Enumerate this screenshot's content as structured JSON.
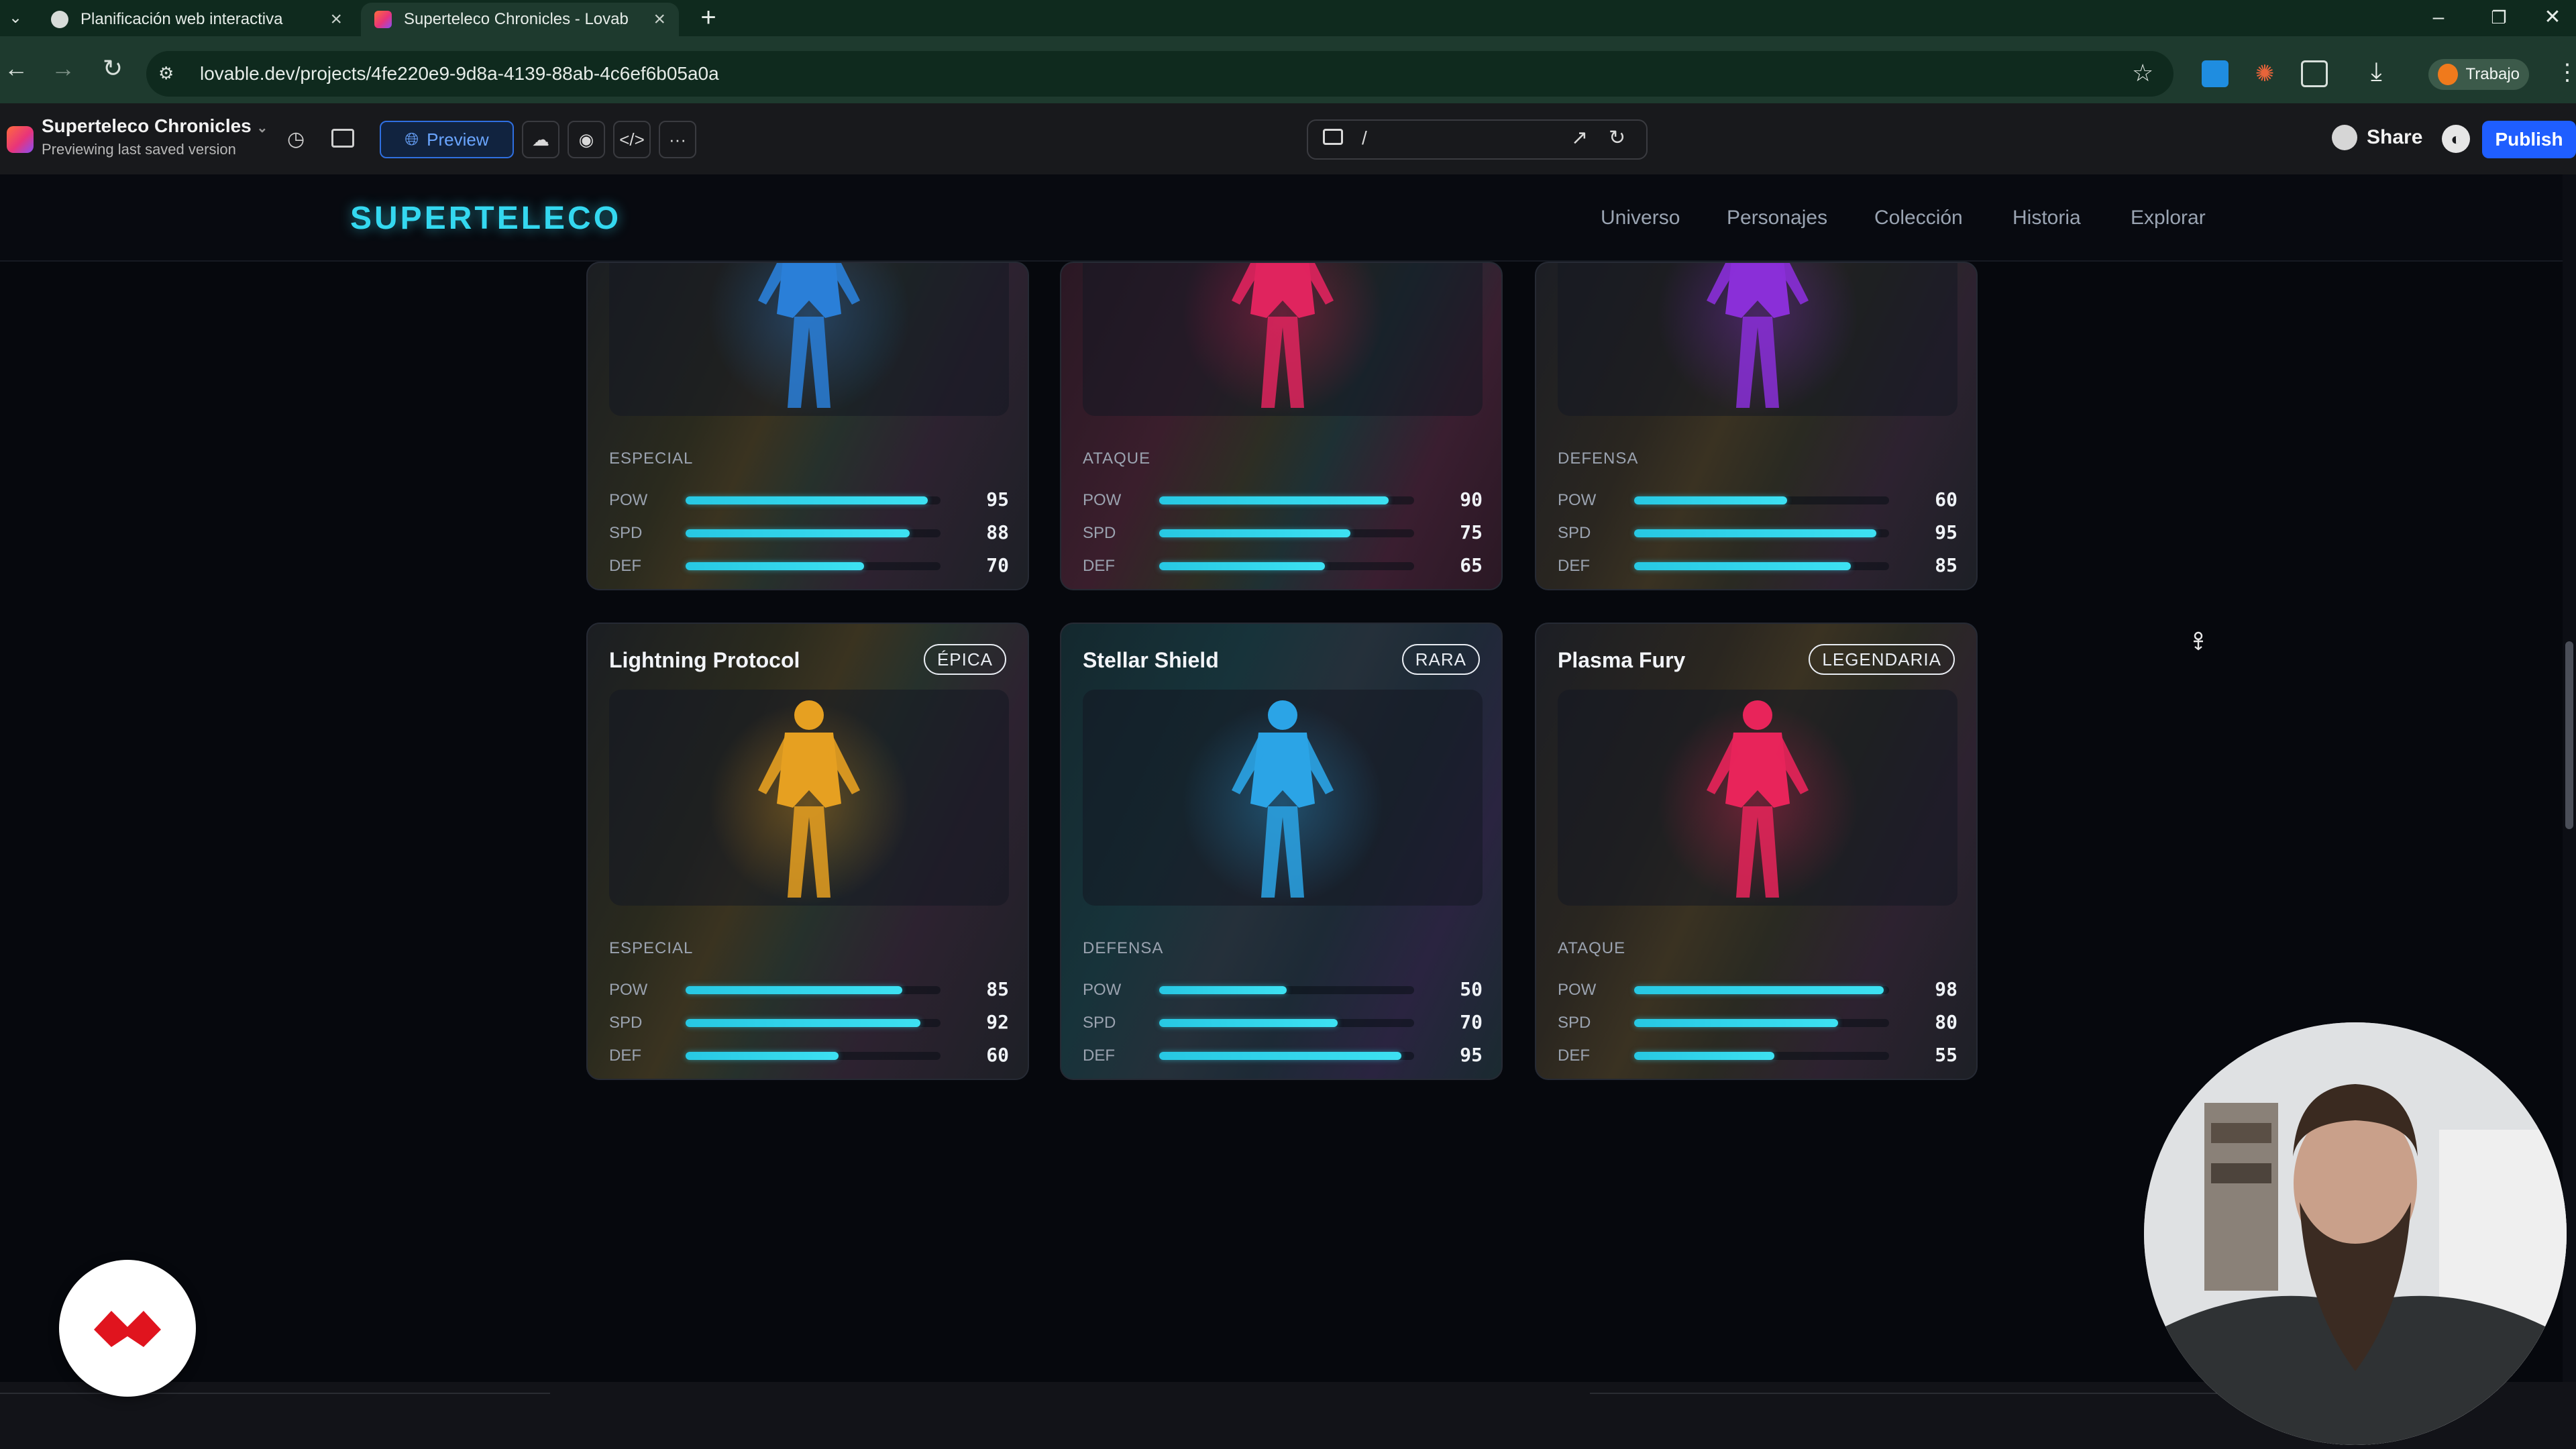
{
  "browser": {
    "tabs": [
      {
        "title": "Planificación web interactiva",
        "active": false
      },
      {
        "title": "Superteleco Chronicles - Lovab",
        "active": true
      }
    ],
    "address": "lovable.dev/projects/4fe220e9-9d8a-4139-88ab-4c6ef6b05a0a",
    "profile_label": "Trabajo"
  },
  "lovable": {
    "project_name": "Superteleco Chronicles",
    "project_status": "Previewing last saved version",
    "preview_label": "Preview",
    "route": "/",
    "share_label": "Share",
    "publish_label": "Publish"
  },
  "site": {
    "brand": "SUPERTELECO",
    "nav": [
      "Universo",
      "Personajes",
      "Colección",
      "Historia",
      "Explorar"
    ],
    "stat_labels": {
      "pow": "POW",
      "spd": "SPD",
      "def": "DEF"
    },
    "cards_top": [
      {
        "role": "ESPECIAL",
        "pow": 95,
        "spd": 88,
        "def": 70,
        "theme": "yellow",
        "hero_color": "#2a7fd8"
      },
      {
        "role": "ATAQUE",
        "pow": 90,
        "spd": 75,
        "def": 65,
        "theme": "pink",
        "hero_color": "#e0245e"
      },
      {
        "role": "DEFENSA",
        "pow": 60,
        "spd": 95,
        "def": 85,
        "theme": "orange",
        "hero_color": "#8a2fd8"
      }
    ],
    "cards_bottom": [
      {
        "name": "Lightning Protocol",
        "rarity": "ÉPICA",
        "role": "ESPECIAL",
        "pow": 85,
        "spd": 92,
        "def": 60,
        "theme": "yellow",
        "hero_color": "#e6a021"
      },
      {
        "name": "Stellar Shield",
        "rarity": "RARA",
        "role": "DEFENSA",
        "pow": 50,
        "spd": 70,
        "def": 95,
        "theme": "teal",
        "hero_color": "#2ba4e6"
      },
      {
        "name": "Plasma Fury",
        "rarity": "LEGENDARIA",
        "role": "ATAQUE",
        "pow": 98,
        "spd": 80,
        "def": 55,
        "theme": "orange",
        "hero_color": "#e8245a"
      }
    ]
  },
  "colors": {
    "accent": "#34d8f0",
    "publish": "#1f5eff",
    "brand_badge": "#e0141e"
  },
  "icons": [
    "back-icon",
    "forward-icon",
    "reload-icon",
    "site-info-icon",
    "star-icon",
    "download-icon",
    "history-icon",
    "sidebar-icon",
    "globe-icon",
    "cloud-icon",
    "palette-icon",
    "code-icon",
    "more-icon",
    "device-icon",
    "open-external-icon",
    "refresh-icon",
    "github-icon",
    "cursor-icon"
  ]
}
